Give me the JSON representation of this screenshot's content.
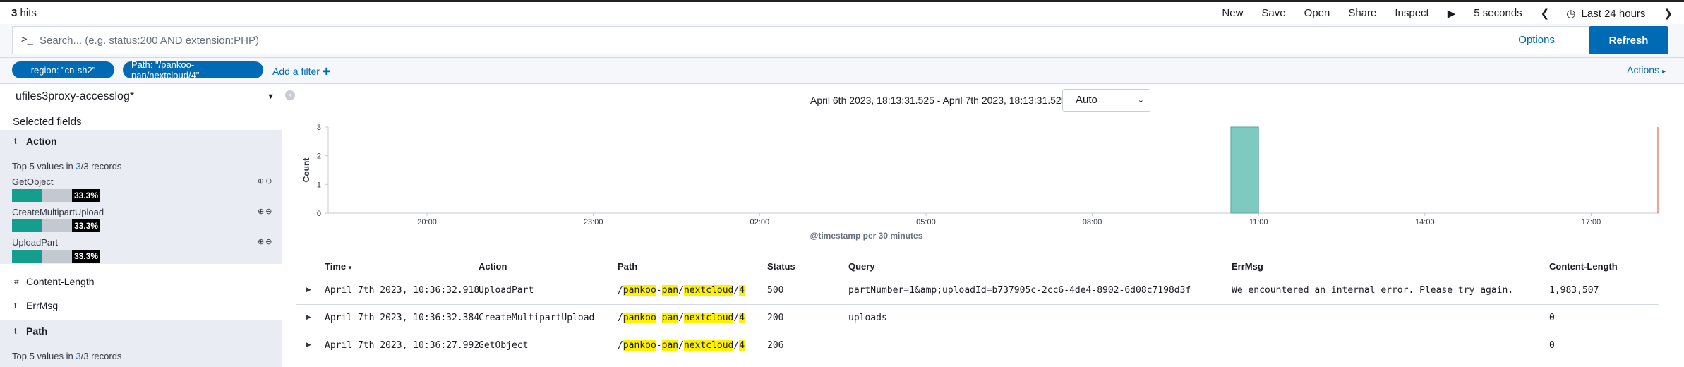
{
  "topbar": {
    "hits_count": "3",
    "hits_label": "hits",
    "nav": [
      "New",
      "Save",
      "Open",
      "Share",
      "Inspect"
    ],
    "refresh_interval": "5 seconds",
    "time_range": "Last 24 hours"
  },
  "search": {
    "prompt": ">_",
    "placeholder": "Search... (e.g. status:200 AND extension:PHP)",
    "options_label": "Options",
    "refresh_label": "Refresh"
  },
  "filters": {
    "pills": [
      "region: \"cn-sh2\"",
      "Path: \"/pankoo-pan/nextcloud/4\""
    ],
    "add_filter_label": "Add a filter",
    "actions_label": "Actions"
  },
  "sidebar": {
    "index_pattern": "ufiles3proxy-accesslog*",
    "selected_fields_title": "Selected fields",
    "fields": [
      {
        "type": "t",
        "name": "Action"
      },
      {
        "type": "#",
        "name": "Content-Length"
      },
      {
        "type": "t",
        "name": "ErrMsg"
      },
      {
        "type": "t",
        "name": "Path"
      }
    ],
    "action_detail": {
      "top_prefix": "Top 5 values in",
      "found": "3",
      "sep": "/",
      "total": "3",
      "suffix": "records",
      "values": [
        {
          "name": "GetObject",
          "pct": "33.3%",
          "fraction": 0.333
        },
        {
          "name": "CreateMultipartUpload",
          "pct": "33.3%",
          "fraction": 0.333
        },
        {
          "name": "UploadPart",
          "pct": "33.3%",
          "fraction": 0.333
        }
      ]
    },
    "path_detail": {
      "top_prefix": "Top 5 values in",
      "found": "3",
      "sep": "/",
      "total": "3",
      "suffix": "records"
    }
  },
  "main": {
    "time_range_text": "April 6th 2023, 18:13:31.525 - April 7th 2023, 18:13:31.525 —",
    "interval": "Auto"
  },
  "chart_data": {
    "type": "bar",
    "x": [
      "20:00",
      "23:00",
      "02:00",
      "05:00",
      "08:00",
      "11:00",
      "14:00",
      "17:00"
    ],
    "ylabel": "Count",
    "xlabel": "@timestamp per 30 minutes",
    "ylim": [
      0,
      3
    ],
    "yticks": [
      0,
      1,
      2,
      3
    ],
    "bars": [
      {
        "time": "10:30",
        "value": 3
      }
    ],
    "color": "#7fcac0"
  },
  "table": {
    "headers": [
      "Time",
      "Action",
      "Path",
      "Status",
      "Query",
      "ErrMsg",
      "Content-Length"
    ],
    "rows": [
      {
        "time": "April 7th 2023, 10:36:32.918",
        "action": "UploadPart",
        "path": [
          "/",
          "pankoo",
          "-",
          "pan",
          "/",
          "nextcloud",
          "/",
          "4"
        ],
        "status": "500",
        "query": "partNumber=1&amp;uploadId=b737905c-2cc6-4de4-8902-6d08c7198d3f",
        "errmsg": "We encountered an internal error. Please try again.",
        "content_length": "1,983,507"
      },
      {
        "time": "April 7th 2023, 10:36:32.384",
        "action": "CreateMultipartUpload",
        "path": [
          "/",
          "pankoo",
          "-",
          "pan",
          "/",
          "nextcloud",
          "/",
          "4"
        ],
        "status": "200",
        "query": "uploads",
        "errmsg": "",
        "content_length": "0"
      },
      {
        "time": "April 7th 2023, 10:36:27.992",
        "action": "GetObject",
        "path": [
          "/",
          "pankoo",
          "-",
          "pan",
          "/",
          "nextcloud",
          "/",
          "4"
        ],
        "status": "206",
        "query": "",
        "errmsg": "",
        "content_length": "0"
      }
    ]
  },
  "colors": {
    "accent": "#006bb4",
    "bar_fill": "#159d8d",
    "highlight": "#fff200"
  }
}
